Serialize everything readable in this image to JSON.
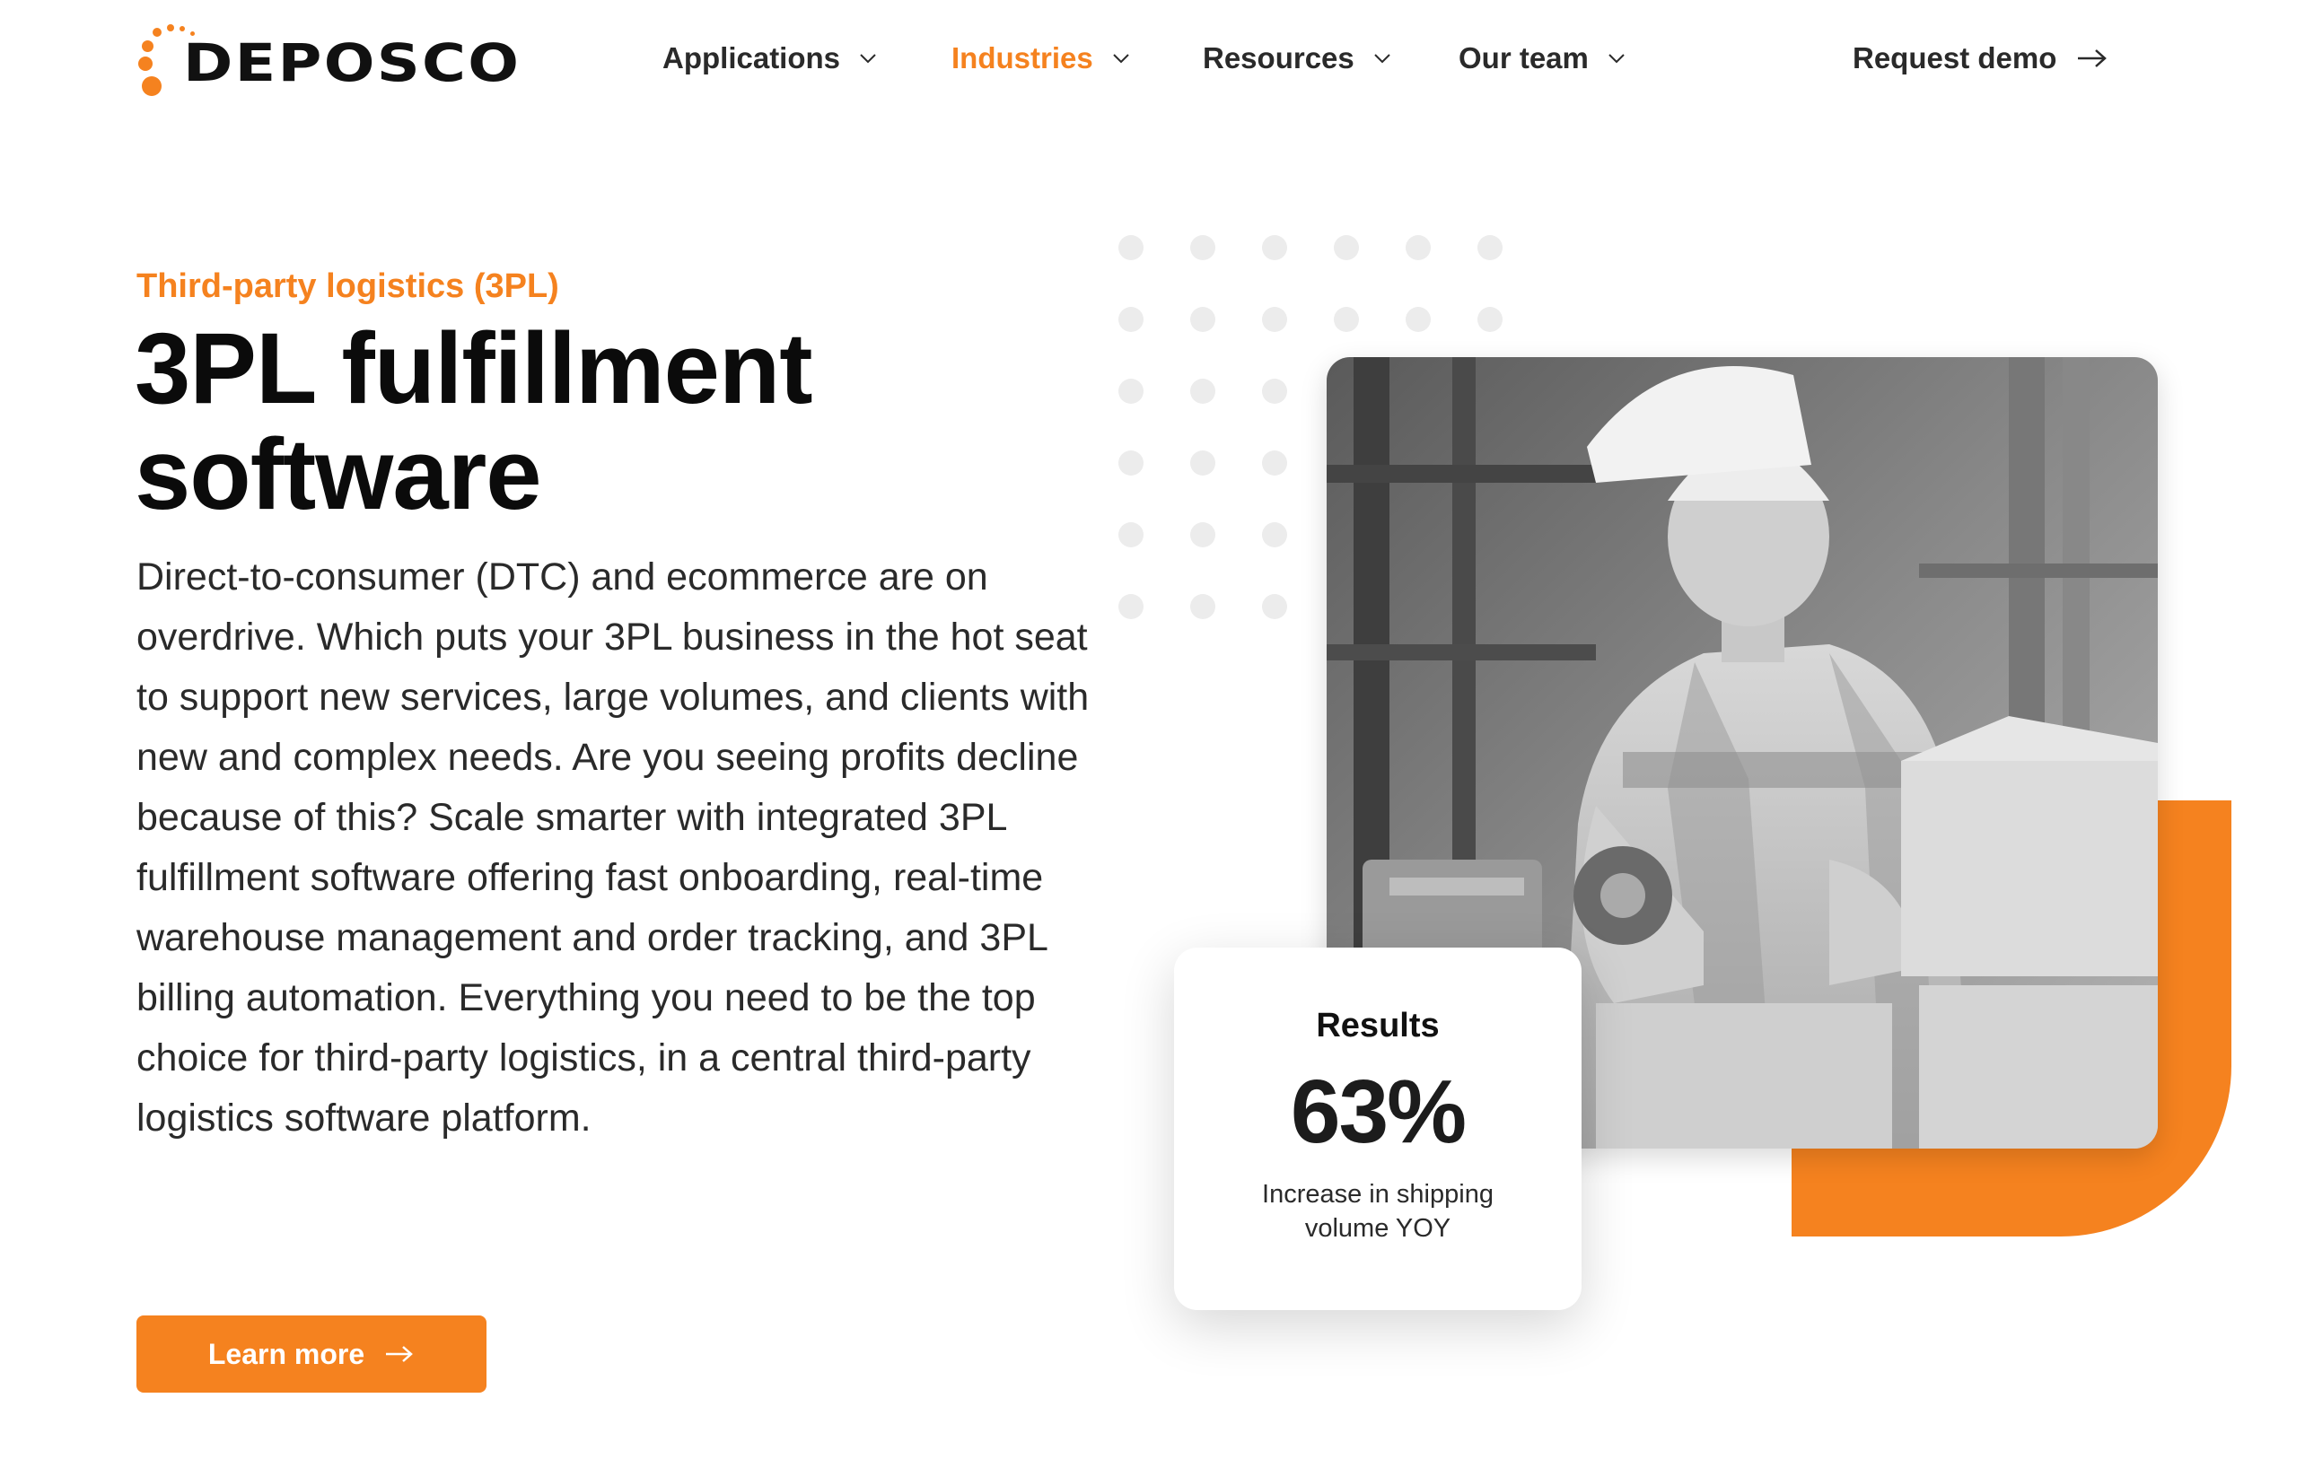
{
  "header": {
    "logo_text": "DEPOSCO",
    "nav": [
      {
        "label": "Applications",
        "active": false
      },
      {
        "label": "Industries",
        "active": true
      },
      {
        "label": "Resources",
        "active": false
      },
      {
        "label": "Our team",
        "active": false
      }
    ],
    "cta_label": "Request demo"
  },
  "hero": {
    "eyebrow": "Third-party logistics (3PL)",
    "title_line1": "3PL fulfillment",
    "title_line2": "software",
    "body": "Direct-to-consumer (DTC) and ecommerce are on overdrive. Which puts your 3PL business in the hot seat to support new services, large volumes, and clients with new and complex needs. Are you seeing profits decline because of this? Scale smarter with integrated 3PL fulfillment software offering fast onboarding, real-time warehouse management and order tracking, and 3PL billing automation. Everything you need to be the top choice for third-party logistics, in a central third-party logistics software platform.",
    "button_label": "Learn more"
  },
  "results_card": {
    "title": "Results",
    "value": "63%",
    "description": "Increase in shipping volume YOY"
  },
  "icons": {
    "nav_chevron": "chevron-down-icon",
    "cta_arrow": "arrow-right-icon"
  },
  "colors": {
    "accent": "#f5821f",
    "text_dark": "#0b0b0b",
    "text_body": "#2a2a2a",
    "dots": "#ececec"
  }
}
